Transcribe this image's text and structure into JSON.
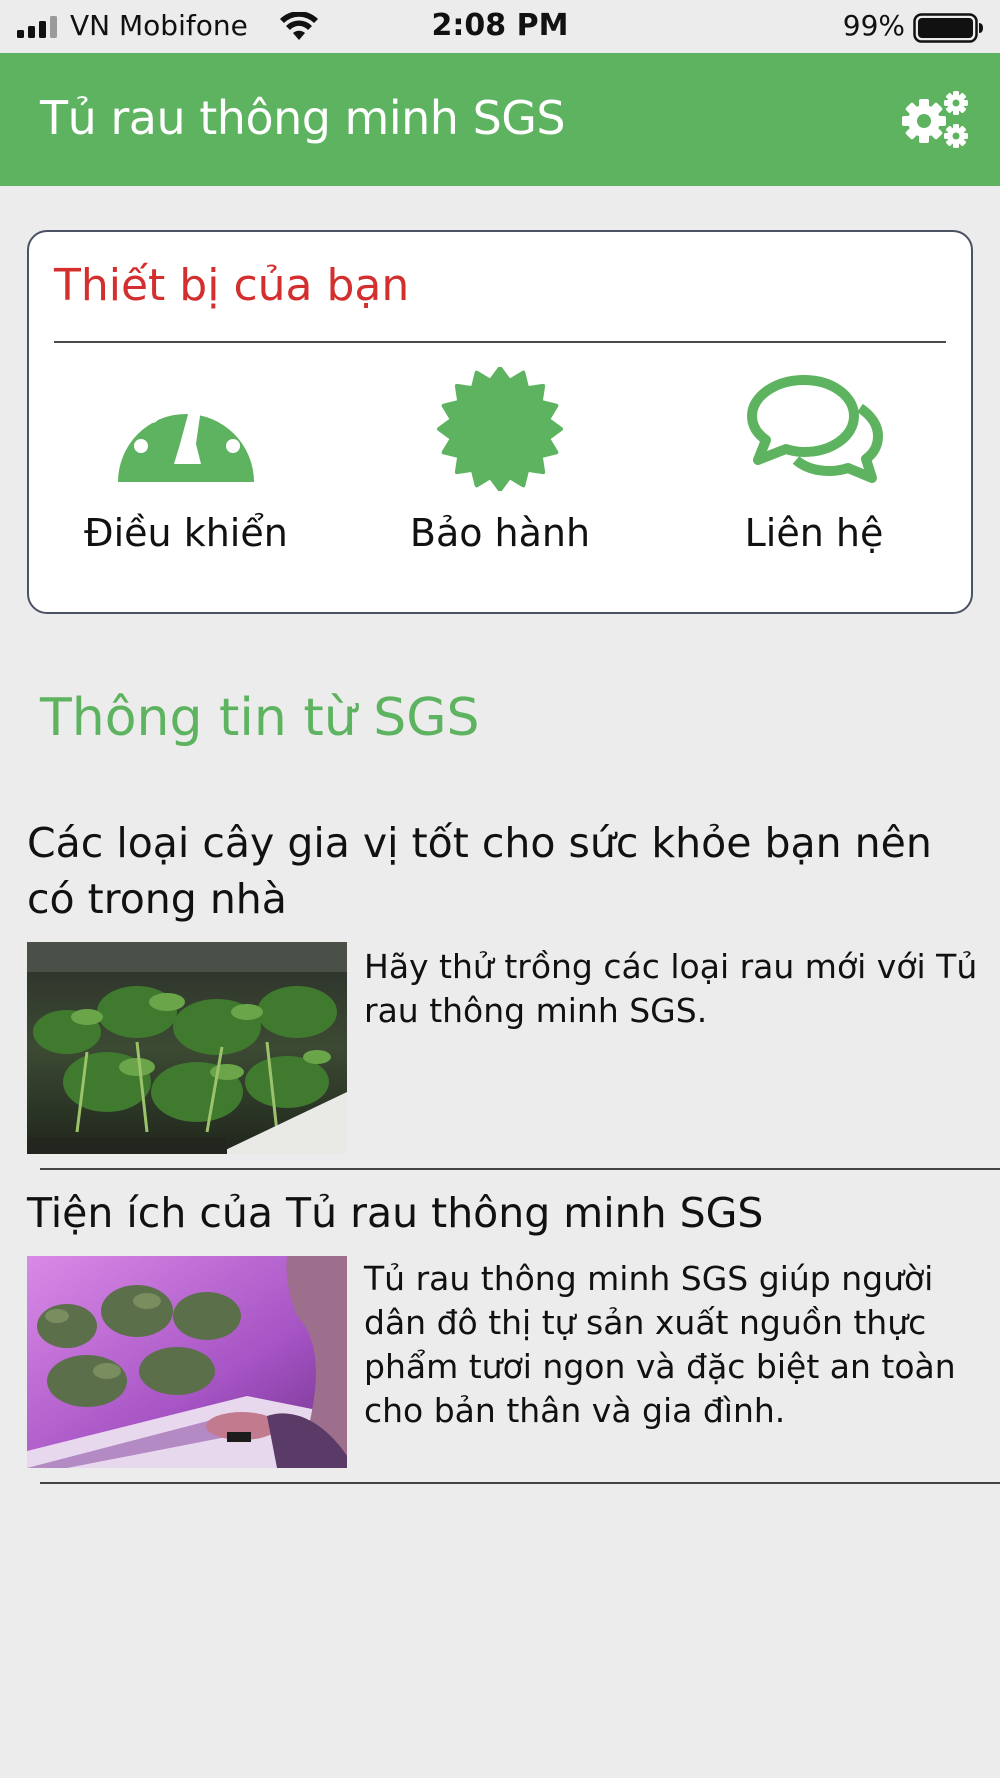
{
  "status_bar": {
    "carrier": "VN Mobifone",
    "time": "2:08 PM",
    "battery": "99%"
  },
  "app_bar": {
    "title": "Tủ rau thông minh SGS",
    "settings_icon": "gears-icon",
    "color": "#5db35f"
  },
  "device_card": {
    "title": "Thiết bị của bạn",
    "title_color": "#d32f2f",
    "actions": [
      {
        "label": "Điều khiển",
        "icon": "dashboard-gauge-icon"
      },
      {
        "label": "Bảo hành",
        "icon": "badge-certificate-icon"
      },
      {
        "label": "Liên hệ",
        "icon": "chat-bubbles-icon"
      }
    ]
  },
  "news": {
    "section_title": "Thông tin từ SGS",
    "articles": [
      {
        "title": "Các loại cây gia vị tốt cho sức khỏe bạn nên có trong nhà",
        "description": "Hãy thử trồng các loại rau mới với Tủ rau thông minh SGS."
      },
      {
        "title": "Tiện ích của Tủ rau thông minh SGS",
        "description": "Tủ rau thông minh SGS giúp người dân đô thị tự sản xuất nguồn thực phẩm tươi ngon và đặc biệt an toàn cho bản thân và gia đình."
      }
    ]
  }
}
